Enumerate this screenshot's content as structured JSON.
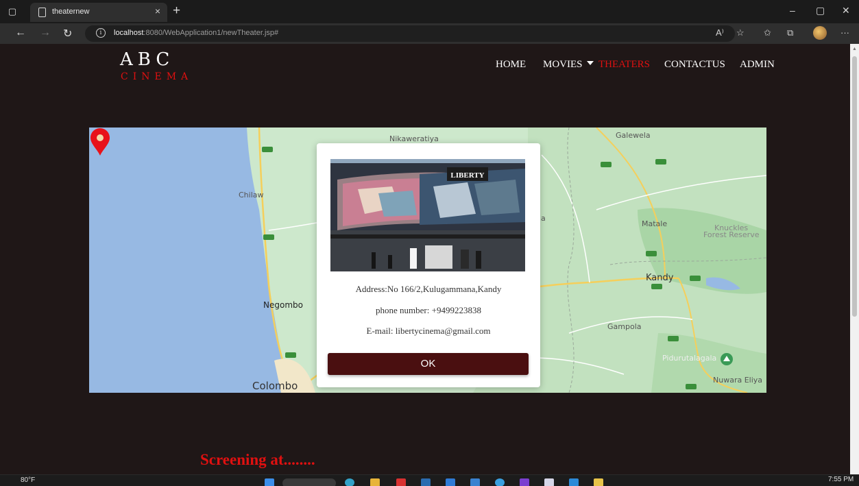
{
  "browser": {
    "tab_title": "theaternew",
    "tab_close": "×",
    "new_tab": "+",
    "url_host": "localhost",
    "url_rest": ":8080/WebApplication1/newTheater.jsp#",
    "win_minimize": "–",
    "win_maximize": "▢",
    "win_close": "✕",
    "more_icon_text": "···",
    "read_aloud_icon_text": "A⁾"
  },
  "site": {
    "logo_main": "ABC",
    "logo_sub": "CINEMA",
    "nav": {
      "home": "HOME",
      "movies": "MOVIES",
      "theaters": "THEATERS",
      "contact": "CONTACTUS",
      "admin": "ADMIN"
    },
    "active_nav": "THEATERS",
    "accent_color": "#e01010",
    "background_color": "#1f1717"
  },
  "map": {
    "labels": {
      "nikaweratiya": "Nikaweratiya",
      "galewela": "Galewela",
      "chilaw": "Chilaw",
      "matale": "Matale",
      "knuckles1": "Knuckles",
      "knuckles2": "Forest Reserve",
      "kandy": "Kandy",
      "negombo": "Negombo",
      "gampola": "Gampola",
      "pidurutalagala": "Pidurutalagala",
      "nuwara_eliya": "Nuwara Eliya",
      "colombo": "Colombo",
      "la": "la"
    },
    "pin_color": "#e8121a"
  },
  "dialog": {
    "photo_sign": "LIBERTY",
    "address": "Address:No 166/2,Kulugammana,Kandy",
    "phone": "phone number: +9499223838",
    "email": "E-mail: libertycinema@gmail.com",
    "ok_label": "OK",
    "ok_color": "#4a0f10"
  },
  "section": {
    "screening_title": "Screening at........"
  },
  "taskbar": {
    "weather": "80°F",
    "time": "7:55 PM"
  }
}
